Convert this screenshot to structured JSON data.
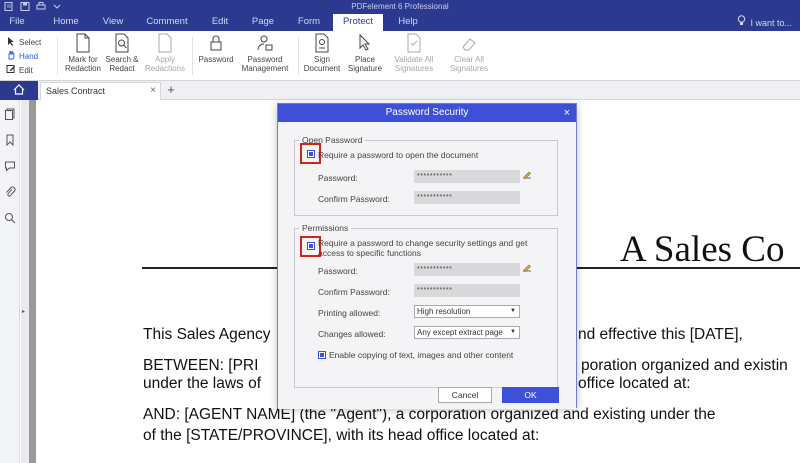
{
  "app": {
    "title": "PDFelement 6 Professional"
  },
  "menu": {
    "items": [
      "File",
      "Home",
      "View",
      "Comment",
      "Edit",
      "Page",
      "Form",
      "Protect",
      "Help"
    ],
    "active": "Protect",
    "search_label": "I want to..."
  },
  "ribbon": {
    "select_label": "Select",
    "hand_label": "Hand",
    "edit_label": "Edit",
    "mark_redaction": "Mark for Redaction",
    "search_redact": "Search & Redact",
    "apply_redactions": "Apply Redactions",
    "password": "Password",
    "password_management": "Password Management",
    "sign_document": "Sign Document",
    "place_signature": "Place Signature",
    "validate_all": "Validate All Signatures",
    "clear_all": "Clear All Signatures"
  },
  "tabs": {
    "document_tab": "Sales Contract",
    "close": "×",
    "add": "+"
  },
  "document": {
    "title": "A Sales Co",
    "lines": [
      "This Sales Agency",
      "nd effective this [DATE],",
      "BETWEEN:   [PRI",
      "poration organized and existin",
      "under the laws of",
      "office located at:",
      "AND:    [AGENT NAME] (the \"Agent\"), a corporation organized and existing under the",
      "of the [STATE/PROVINCE], with its head office located at:"
    ]
  },
  "dialog": {
    "title": "Password Security",
    "close": "×",
    "open_password": {
      "legend": "Open Password",
      "checkbox_label": "Require a password to open the document",
      "password_label": "Password:",
      "password_value": "***********",
      "confirm_label": "Confirm Password:",
      "confirm_value": "***********"
    },
    "permissions": {
      "legend": "Permissions",
      "checkbox_label_line1": "Require a password to change security settings and get",
      "checkbox_label_line2": "access to specific functions",
      "password_label": "Password:",
      "password_value": "***********",
      "confirm_label": "Confirm Password:",
      "confirm_value": "***********",
      "printing_label": "Printing allowed:",
      "printing_value": "High resolution",
      "changes_label": "Changes allowed:",
      "changes_value": "Any except extract page",
      "copying_label": "Enable copying of text, images and other content"
    },
    "cancel": "Cancel",
    "ok": "OK"
  },
  "colors": {
    "brand": "#2b3a8f",
    "accent": "#3e4fd8",
    "highlight": "#c9291f"
  }
}
